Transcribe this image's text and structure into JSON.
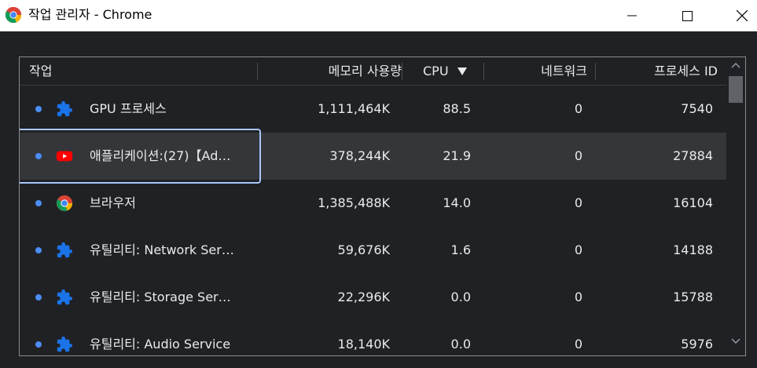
{
  "window": {
    "title": "작업 관리자 - Chrome"
  },
  "columns": {
    "task": "작업",
    "memory": "메모리 사용량",
    "cpu": "CPU",
    "network": "네트워크",
    "pid": "프로세스 ID"
  },
  "sort": {
    "column": "cpu",
    "direction": "descending"
  },
  "rows": [
    {
      "icon": "puzzle-icon",
      "task": "GPU 프로세스",
      "memory": "1,111,464K",
      "cpu": "88.5",
      "network": "0",
      "pid": "7540"
    },
    {
      "icon": "youtube-icon",
      "task": "애플리케이션:(27)【Ad…",
      "memory": "378,244K",
      "cpu": "21.9",
      "network": "0",
      "pid": "27884",
      "selected": true
    },
    {
      "icon": "chrome-icon",
      "task": "브라우저",
      "memory": "1,385,488K",
      "cpu": "14.0",
      "network": "0",
      "pid": "16104"
    },
    {
      "icon": "puzzle-icon",
      "task": "유틸리티: Network Ser…",
      "memory": "59,676K",
      "cpu": "1.6",
      "network": "0",
      "pid": "14188"
    },
    {
      "icon": "puzzle-icon",
      "task": "유틸리티: Storage Ser…",
      "memory": "22,296K",
      "cpu": "0.0",
      "network": "0",
      "pid": "15788"
    },
    {
      "icon": "puzzle-icon",
      "task": "유틸리티: Audio Service",
      "memory": "18,140K",
      "cpu": "0.0",
      "network": "0",
      "pid": "5976"
    }
  ],
  "colors": {
    "background": "#202124",
    "selected_row": "#35363a",
    "focus_ring": "#a8c7fa",
    "dot": "#4c8df6",
    "puzzle": "#1a73e8",
    "youtube": "#ff0000"
  }
}
